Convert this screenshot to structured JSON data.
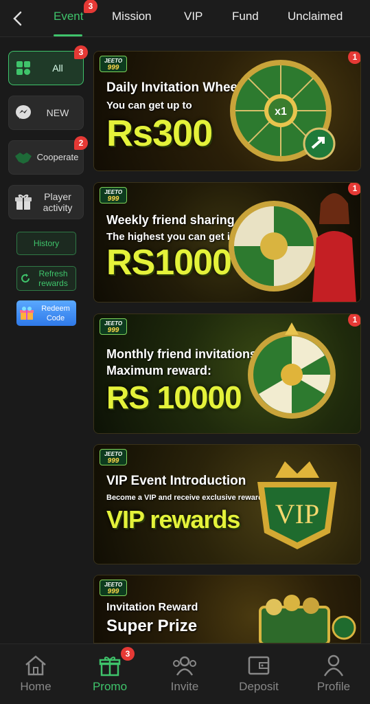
{
  "header": {
    "tabs": [
      {
        "label": "Event",
        "badge": "3"
      },
      {
        "label": "Mission"
      },
      {
        "label": "VIP"
      },
      {
        "label": "Fund"
      },
      {
        "label": "Unclaimed"
      }
    ],
    "active_tab": "Event"
  },
  "sidebar": {
    "items": [
      {
        "label": "All",
        "badge": "3",
        "icon": "grid-icon"
      },
      {
        "label": "NEW",
        "icon": "messenger-icon"
      },
      {
        "label": "Cooperate",
        "badge": "2",
        "icon": "handshake-icon"
      },
      {
        "label": "Player activity",
        "icon": "gift-icon"
      }
    ],
    "buttons": {
      "history": "History",
      "refresh": "Refresh rewards",
      "redeem": "Redeem Code"
    }
  },
  "banners": [
    {
      "logo_top": "JEETO",
      "logo_bottom": "999",
      "title": "Daily Invitation Wheel",
      "subtitle": "You can get up to",
      "amount": "Rs300",
      "badge": "1",
      "wheel_center": "x1"
    },
    {
      "logo_top": "JEETO",
      "logo_bottom": "999",
      "title": "Weekly friend sharing",
      "subtitle": "The highest you can get is",
      "amount": "RS1000",
      "badge": "1"
    },
    {
      "logo_top": "JEETO",
      "logo_bottom": "999",
      "title": "Monthly friend invitations",
      "subtitle": "Maximum reward:",
      "amount": "RS 10000",
      "badge": "1"
    },
    {
      "logo_top": "JEETO",
      "logo_bottom": "999",
      "title": "VIP Event Introduction",
      "subtitle": "Become a VIP and receive exclusive rewards",
      "amount": "VIP rewards",
      "emblem": "VIP"
    },
    {
      "logo_top": "JEETO",
      "logo_bottom": "999",
      "title": "Invitation Reward",
      "subtitle": "Super Prize"
    }
  ],
  "bottom_nav": [
    {
      "label": "Home",
      "icon": "home-icon"
    },
    {
      "label": "Promo",
      "icon": "gift-icon",
      "badge": "3"
    },
    {
      "label": "Invite",
      "icon": "invite-icon"
    },
    {
      "label": "Deposit",
      "icon": "wallet-icon"
    },
    {
      "label": "Profile",
      "icon": "profile-icon"
    }
  ],
  "colors": {
    "accent": "#3fc46b",
    "badge": "#e53935",
    "gold": "#e4f23a",
    "background": "#1a1a1a"
  }
}
